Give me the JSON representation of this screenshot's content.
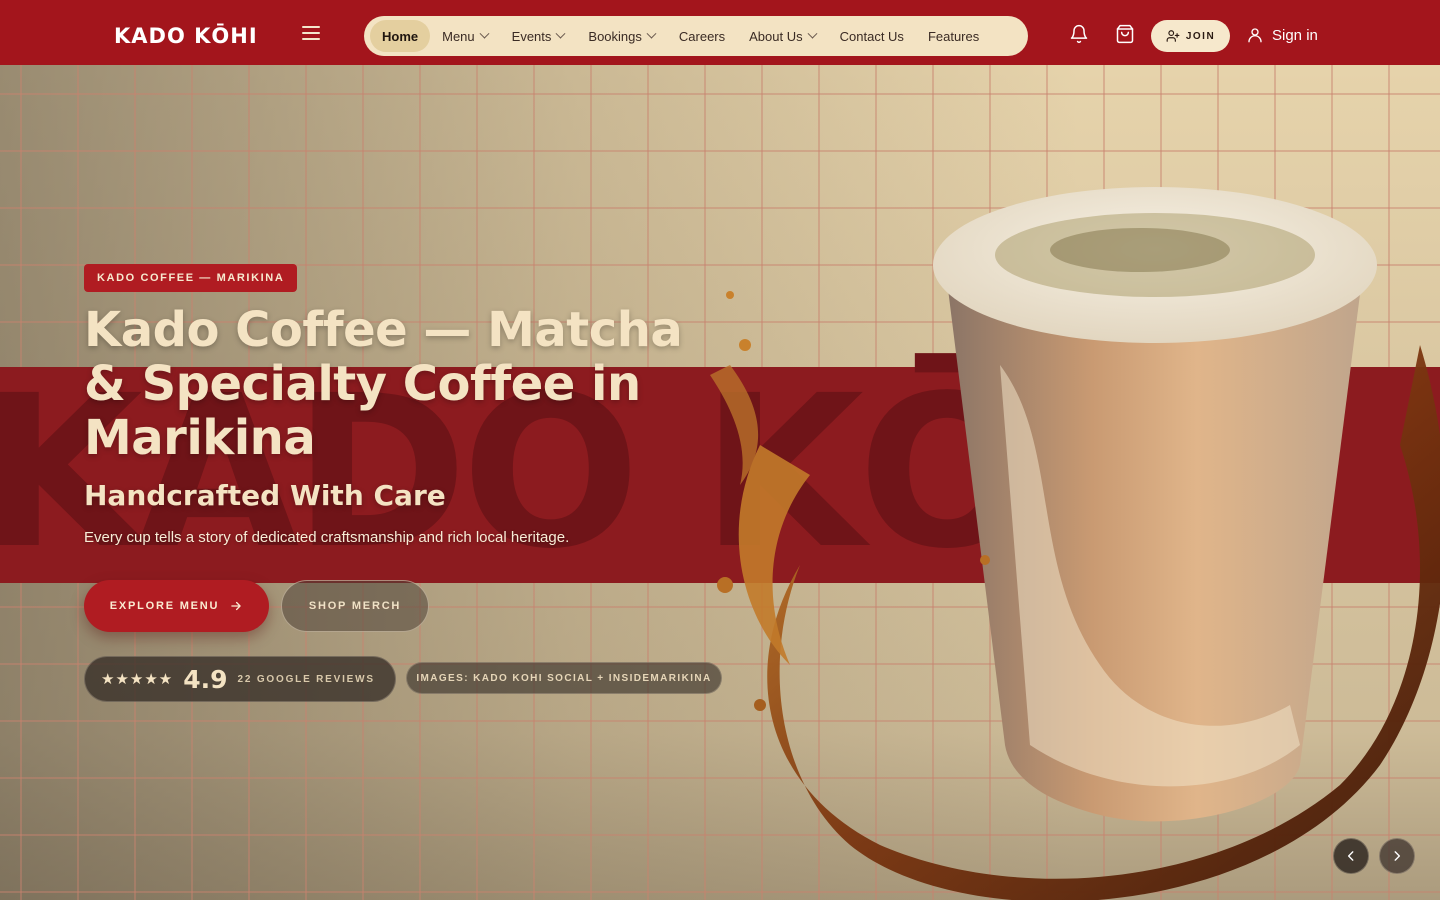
{
  "brand": {
    "logo_text": "KADO KŌHI"
  },
  "nav": {
    "items": [
      {
        "label": "Home",
        "active": true,
        "dropdown": false
      },
      {
        "label": "Menu",
        "active": false,
        "dropdown": true
      },
      {
        "label": "Events",
        "active": false,
        "dropdown": true
      },
      {
        "label": "Bookings",
        "active": false,
        "dropdown": true
      },
      {
        "label": "Careers",
        "active": false,
        "dropdown": false
      },
      {
        "label": "About Us",
        "active": false,
        "dropdown": true
      },
      {
        "label": "Contact Us",
        "active": false,
        "dropdown": false
      },
      {
        "label": "Features",
        "active": false,
        "dropdown": false
      }
    ]
  },
  "header_actions": {
    "notification_icon": "bell-icon",
    "cart_icon": "shopping-bag-icon",
    "join_label": "JOIN",
    "signin_label": "Sign in"
  },
  "hero": {
    "background_word": "KADO KŌ",
    "badge": "KADO COFFEE — MARIKINA",
    "title": "Kado Coffee — Matcha & Specialty Coffee in Marikina",
    "subtitle": "Handcrafted With Care",
    "description": "Every cup tells a story of dedicated craftsmanship and rich local heritage.",
    "primary_cta": "EXPLORE MENU",
    "secondary_cta": "SHOP MERCH",
    "rating": {
      "stars": "★★★★★",
      "score": "4.9",
      "reviews_label": "22 GOOGLE REVIEWS"
    },
    "image_credit": "IMAGES: KADO KOHI SOCIAL + INSIDEMARIKINA"
  },
  "colors": {
    "brand_red": "#a3151c",
    "cream": "#f3e3c3",
    "band_red": "#8c1b1f"
  }
}
